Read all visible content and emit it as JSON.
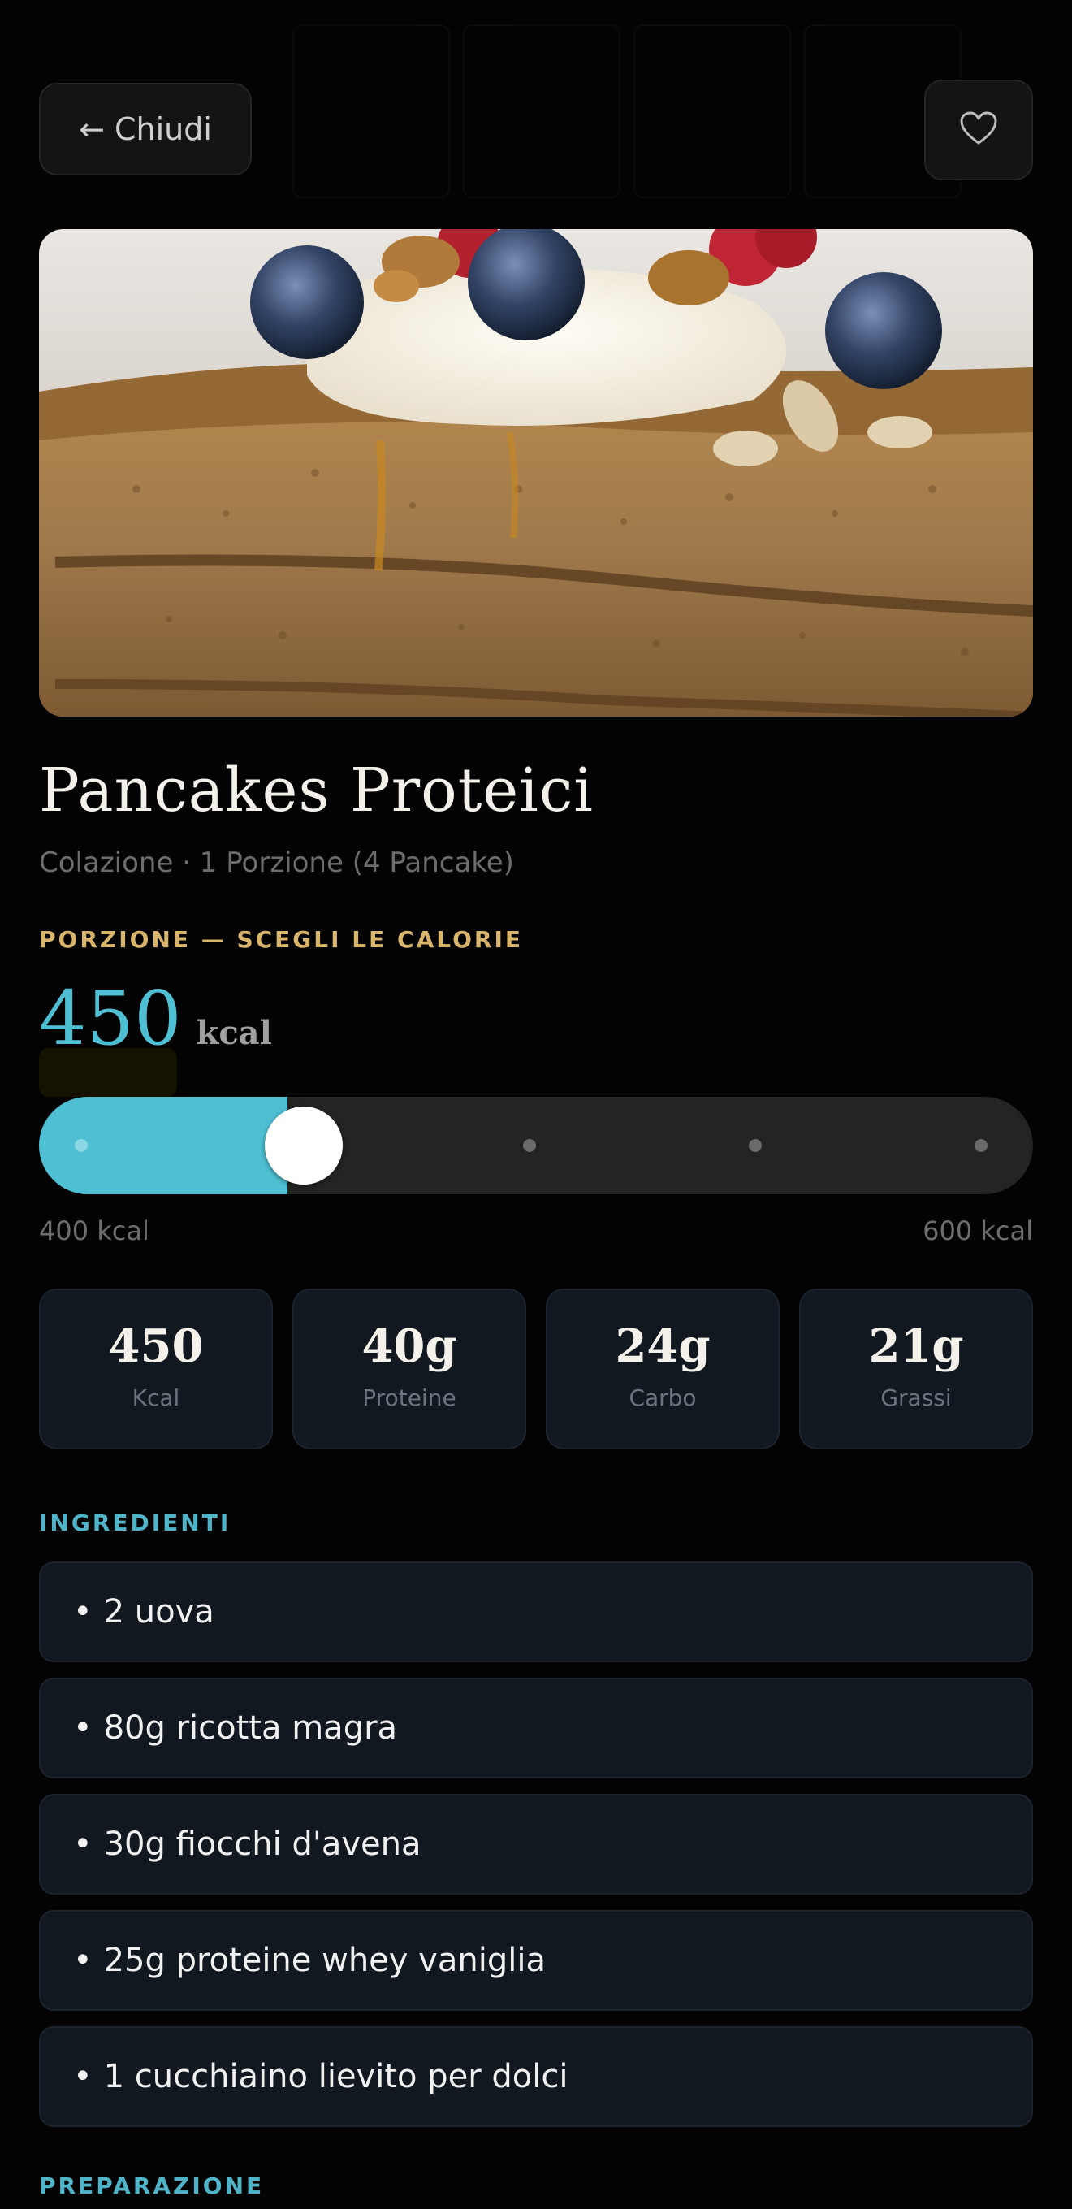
{
  "header": {
    "close_label": "← Chiudi",
    "favorite_icon": "heart-outline-icon"
  },
  "recipe": {
    "title": "Pancakes Proteici",
    "subtitle": "Colazione · 1 Porzione (4 Pancake)"
  },
  "portion": {
    "section_label": "PORZIONE — SCEGLI LE CALORIE",
    "kcal_value": "450",
    "kcal_unit": "kcal",
    "slider_level": 0.25,
    "range_min": "400 kcal",
    "range_max": "600 kcal"
  },
  "macros": [
    {
      "value": "450",
      "label": "Kcal"
    },
    {
      "value": "40g",
      "label": "Proteine"
    },
    {
      "value": "24g",
      "label": "Carbo"
    },
    {
      "value": "21g",
      "label": "Grassi"
    }
  ],
  "ingredients": {
    "section_label": "INGREDIENTI",
    "items": [
      "2 uova",
      "80g ricotta magra",
      "30g fiocchi d'avena",
      "25g proteine whey vaniglia",
      "1 cucchiaino lievito per dolci"
    ]
  },
  "preparation": {
    "section_label": "PREPARAZIONE"
  },
  "colors": {
    "accent": "#4fc0d4",
    "gold_label": "#d8b56a",
    "background": "#030303",
    "card": "#121820"
  }
}
